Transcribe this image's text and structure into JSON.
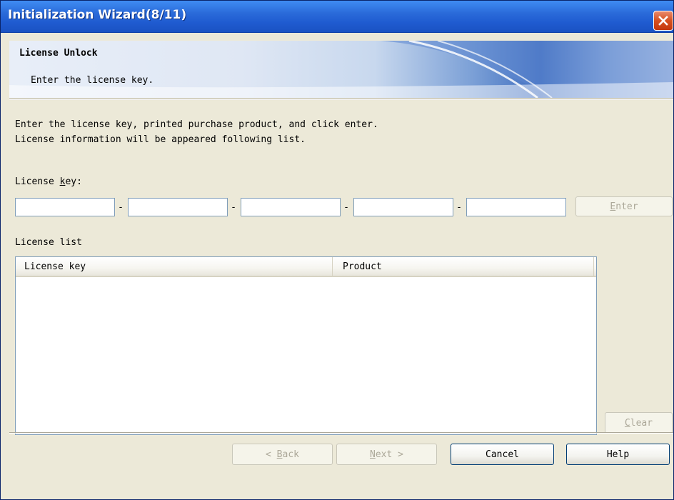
{
  "window": {
    "title": "Initialization Wizard(8/11)"
  },
  "header": {
    "title": "License Unlock",
    "subtitle": "Enter the license key."
  },
  "instructions": {
    "line1": "Enter the license key, printed purchase product, and click enter.",
    "line2": "License information will be appeared following list."
  },
  "license_key": {
    "label_pre": "License ",
    "label_mnemonic": "k",
    "label_post": "ey:",
    "fields": [
      "",
      "",
      "",
      "",
      ""
    ],
    "separator": "-",
    "enter_mnemonic": "E",
    "enter_rest": "nter",
    "enter_enabled": false
  },
  "license_list": {
    "label": "License list",
    "columns": [
      "License key",
      "Product"
    ],
    "rows": [],
    "clear_mnemonic": "C",
    "clear_rest": "lear",
    "clear_enabled": false
  },
  "footer": {
    "back_pre": "< ",
    "back_mnemonic": "B",
    "back_rest": "ack",
    "back_enabled": false,
    "next_mnemonic": "N",
    "next_rest": "ext >",
    "next_enabled": false,
    "cancel_label": "Cancel",
    "help_label": "Help"
  },
  "colors": {
    "titlebar": "#2a6ad9",
    "close_button": "#d6501f",
    "dialog_background": "#ece9d8",
    "disabled_text": "#aca899"
  },
  "icons": {
    "close": "close-x-icon"
  }
}
